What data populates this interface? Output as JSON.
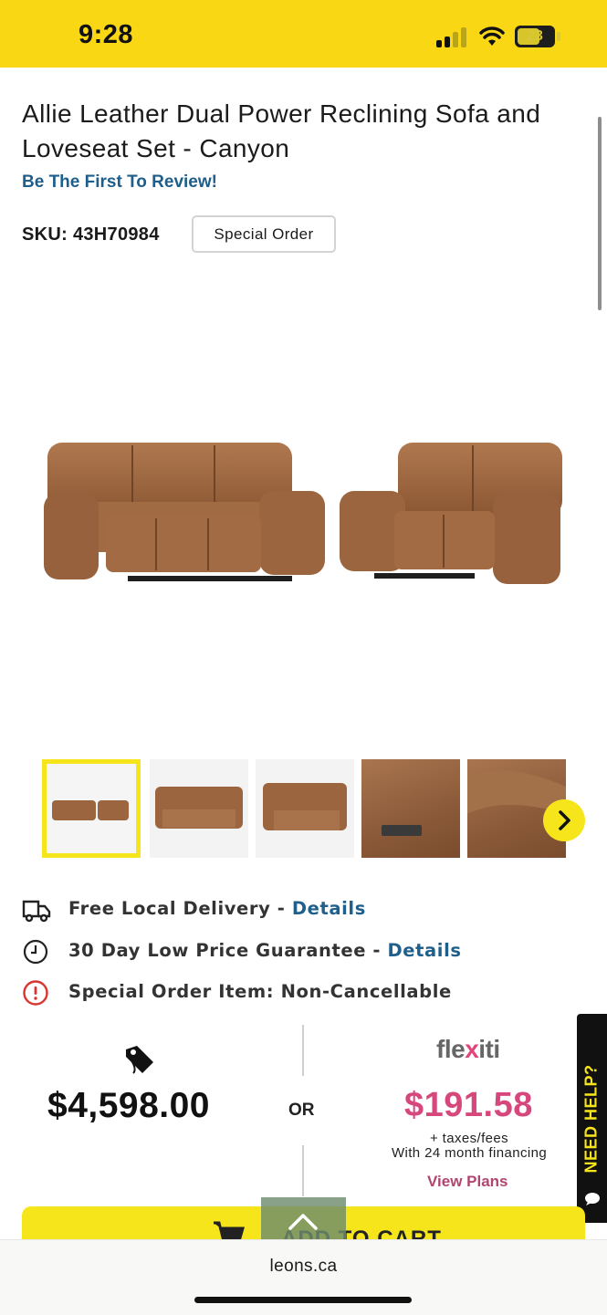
{
  "status_bar": {
    "time": "9:28",
    "battery": "23",
    "background": "#fad714"
  },
  "product": {
    "title": "Allie Leather Dual Power Reclining Sofa and Loveseat Set - Canyon",
    "review_link": "Be The First To Review!",
    "sku": "SKU: 43H70984",
    "badge": "Special Order"
  },
  "gallery": {
    "main_image": "sofa-and-loveseat-image",
    "thumbnails": [
      "set-front-view",
      "sofa-front-view",
      "loveseat-angle-view",
      "power-button-closeup",
      "armrest-closeup"
    ],
    "selected_index": 0,
    "next_icon": "chevron-right-icon"
  },
  "features": [
    {
      "icon": "delivery-truck-icon",
      "text": "Free Local Delivery - ",
      "link": "Details"
    },
    {
      "icon": "clock-icon",
      "text": "30 Day Low Price Guarantee - ",
      "link": "Details"
    },
    {
      "icon": "alert-circle-icon",
      "text": "Special Order Item: Non-Cancellable",
      "link": ""
    }
  ],
  "pricing": {
    "price": "$4,598.00",
    "or": "OR",
    "flexiti_pre": "fle",
    "flexiti_x": "x",
    "flexiti_post": "iti",
    "monthly": "$191.58",
    "taxes": "+ taxes/fees",
    "financing": "With 24 month financing",
    "view_plans": "View Plans",
    "accent": "#d6477c"
  },
  "help_tab": {
    "label": "NEED HELP?",
    "color": "#f7e51b"
  },
  "cart": {
    "label": "ADD TO CART"
  },
  "browser": {
    "url": "leons.ca"
  }
}
